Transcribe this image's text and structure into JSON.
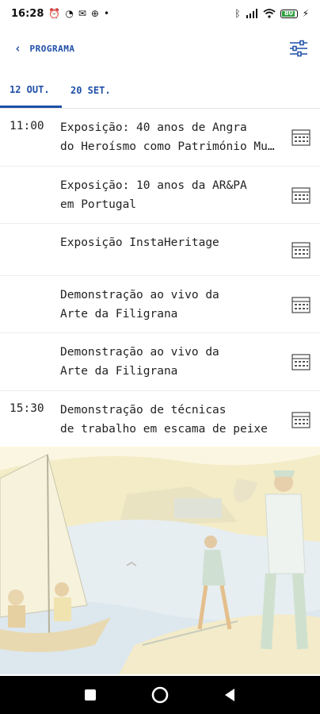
{
  "status_bar": {
    "time": "16:28",
    "left_icons": [
      "alarm-icon",
      "whatsapp-icon",
      "mail-icon",
      "vpn-icon",
      "dot-icon"
    ],
    "right_icons": [
      "bluetooth-icon",
      "signal-icon",
      "wifi-icon"
    ],
    "battery_level": "80"
  },
  "app_bar": {
    "back_label": "PROGRAMA"
  },
  "tabs": [
    {
      "label": "12 OUT."
    },
    {
      "label": "20 SET."
    }
  ],
  "events": [
    {
      "time": "11:00",
      "line1": "Exposição: 40 anos de Angra",
      "line2": "do Heroísmo como Património Mundial"
    },
    {
      "time": "",
      "line1": "Exposição: 10 anos da AR&PA",
      "line2": "em Portugal"
    },
    {
      "time": "",
      "line1": "Exposição InstaHeritage",
      "line2": ""
    },
    {
      "time": "",
      "line1": "Demonstração ao vivo da",
      "line2": "Arte da Filigrana"
    },
    {
      "time": "",
      "line1": "Demonstração ao vivo da",
      "line2": "Arte da Filigrana"
    },
    {
      "time": "15:30",
      "line1": "Demonstração de técnicas",
      "line2": "de trabalho em escama de peixe"
    }
  ],
  "colors": {
    "accent": "#1f4fa8",
    "text": "#222222"
  }
}
